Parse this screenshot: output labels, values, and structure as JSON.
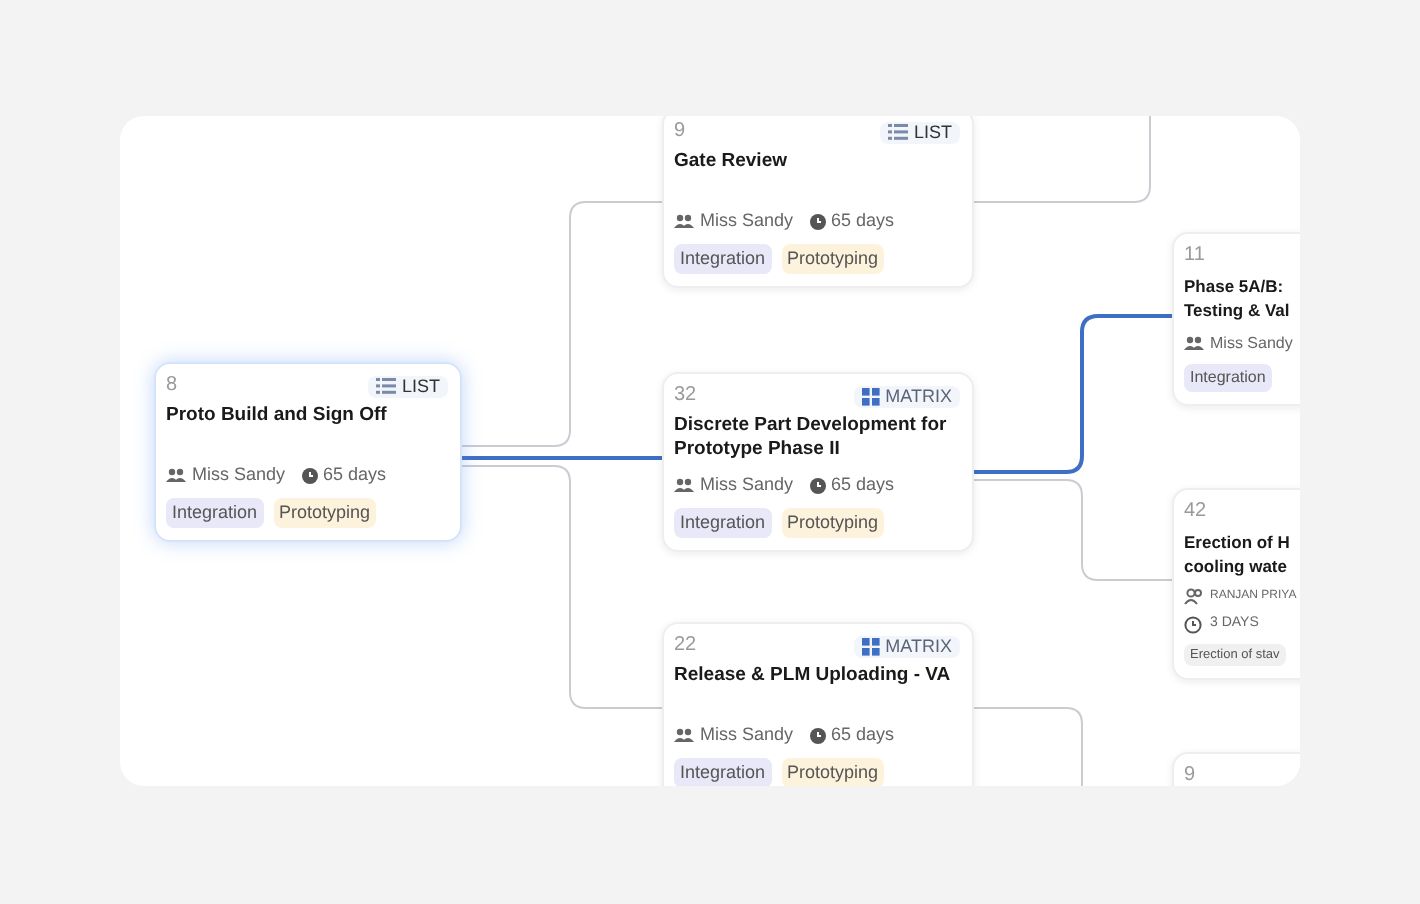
{
  "cards": [
    {
      "kind": "full",
      "id": "8",
      "badge": {
        "kind": "list",
        "label": "LIST"
      },
      "title": "Proto Build and Sign Off",
      "owner": "Miss Sandy",
      "duration": "65 days",
      "tags": [
        {
          "label": "Integration",
          "color": "#e8e8f8"
        },
        {
          "label": "Prototyping",
          "color": "#fdf3dc"
        }
      ],
      "selected": true
    },
    {
      "kind": "full",
      "id": "9",
      "badge": {
        "kind": "list",
        "label": "LIST"
      },
      "title": "Gate Review",
      "owner": "Miss Sandy",
      "duration": "65 days",
      "tags": [
        {
          "label": "Integration",
          "color": "#e8e8f8"
        },
        {
          "label": "Prototyping",
          "color": "#fdf3dc"
        }
      ],
      "selected": false
    },
    {
      "kind": "full",
      "id": "32",
      "badge": {
        "kind": "matrix",
        "label": "MATRIX"
      },
      "title": "Discrete Part Development for Prototype Phase II",
      "owner": "Miss Sandy",
      "duration": "65 days",
      "tags": [
        {
          "label": "Integration",
          "color": "#e8e8f8"
        },
        {
          "label": "Prototyping",
          "color": "#fdf3dc"
        }
      ],
      "selected": false
    },
    {
      "kind": "full",
      "id": "22",
      "badge": {
        "kind": "matrix",
        "label": "MATRIX"
      },
      "title": "Release & PLM Uploading - VA",
      "owner": "Miss Sandy",
      "duration": "65 days",
      "tags": [
        {
          "label": "Integration",
          "color": "#e8e8f8"
        },
        {
          "label": "Prototyping",
          "color": "#fdf3dc"
        }
      ],
      "selected": false
    },
    {
      "kind": "edge",
      "id": "11",
      "title": "Phase 5A/B:\nTesting & Val",
      "owner": "Miss Sandy",
      "tags": [
        {
          "label": "Integration",
          "color": "#e8e8f8"
        }
      ],
      "selected": false
    },
    {
      "kind": "edge-caps",
      "id": "42",
      "title": "Erection of H\ncooling wate",
      "owner": "RANJAN PRIYA",
      "duration": "3 DAYS",
      "tags": [
        {
          "label": "Erection of stav",
          "color": "#f0f0f0"
        }
      ],
      "selected": false
    },
    {
      "kind": "edge",
      "id": "9",
      "selected": false
    }
  ]
}
